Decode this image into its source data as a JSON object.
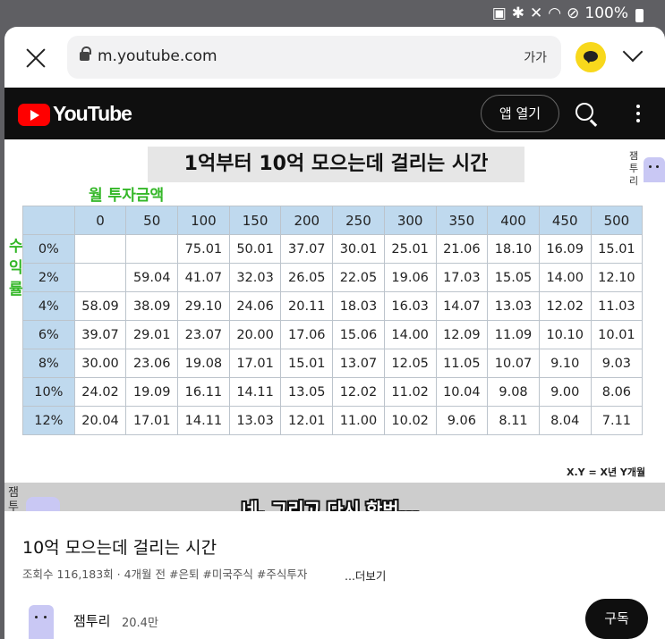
{
  "status": {
    "battery": "100%"
  },
  "browser": {
    "url": "m.youtube.com",
    "font_size_label": "가가"
  },
  "youtube": {
    "brand": "YouTube",
    "open_app": "앱 열기"
  },
  "video": {
    "title": "1억부터 10억 모으는데 걸리는 시간",
    "mascot_label": "잼투리",
    "axis_month": "월 투자금액",
    "axis_rate": "수익률",
    "columns": [
      "0",
      "50",
      "100",
      "150",
      "200",
      "250",
      "300",
      "350",
      "400",
      "450",
      "500"
    ],
    "rows": [
      {
        "rate": "0%",
        "cells": [
          "",
          "",
          "75.01",
          "50.01",
          "37.07",
          "30.01",
          "25.01",
          "21.06",
          "18.10",
          "16.09",
          "15.01"
        ]
      },
      {
        "rate": "2%",
        "cells": [
          "",
          "59.04",
          "41.07",
          "32.03",
          "26.05",
          "22.05",
          "19.06",
          "17.03",
          "15.05",
          "14.00",
          "12.10"
        ]
      },
      {
        "rate": "4%",
        "cells": [
          "58.09",
          "38.09",
          "29.10",
          "24.06",
          "20.11",
          "18.03",
          "16.03",
          "14.07",
          "13.03",
          "12.02",
          "11.03"
        ]
      },
      {
        "rate": "6%",
        "cells": [
          "39.07",
          "29.01",
          "23.07",
          "20.00",
          "17.06",
          "15.06",
          "14.00",
          "12.09",
          "11.09",
          "10.10",
          "10.01"
        ]
      },
      {
        "rate": "8%",
        "cells": [
          "30.00",
          "23.06",
          "19.08",
          "17.01",
          "15.01",
          "13.07",
          "12.05",
          "11.05",
          "10.07",
          "9.10",
          "9.03"
        ]
      },
      {
        "rate": "10%",
        "cells": [
          "24.02",
          "19.09",
          "16.11",
          "14.11",
          "13.05",
          "12.02",
          "11.02",
          "10.04",
          "9.08",
          "9.00",
          "8.06"
        ]
      },
      {
        "rate": "12%",
        "cells": [
          "20.04",
          "17.01",
          "14.11",
          "13.03",
          "12.01",
          "11.00",
          "10.02",
          "9.06",
          "8.11",
          "8.04",
          "7.11"
        ]
      }
    ],
    "note": "X.Y = X년 Y개월",
    "subtitle": "네, 그리고 다시 한번..."
  },
  "info": {
    "title": "10억 모으는데 걸리는 시간",
    "meta": "조회수 116,183회 · 4개월 전  #은퇴 #미국주식 #주식투자",
    "more": "...더보기",
    "channel_name": "잼투리",
    "subscribers": "20.4만",
    "subscribe": "구독"
  }
}
